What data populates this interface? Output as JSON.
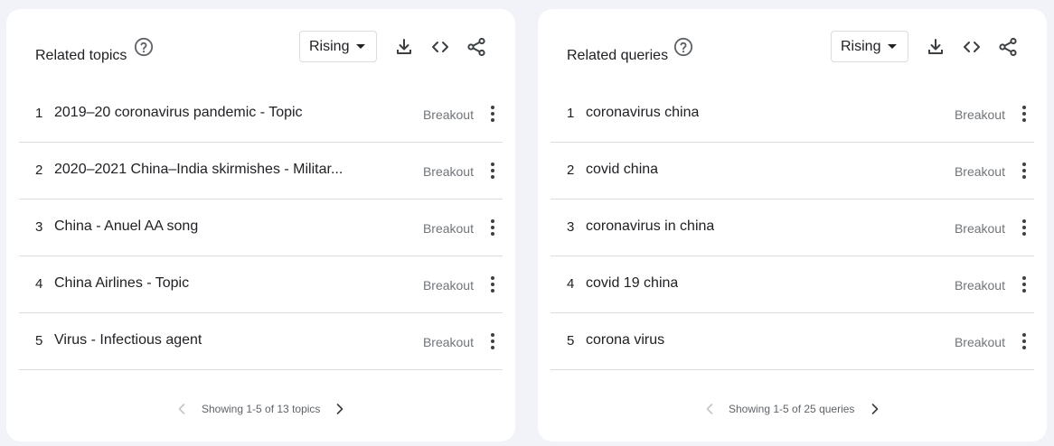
{
  "topics": {
    "title": "Related topics",
    "dropdown_value": "Rising",
    "icons": {
      "help": "help-circle-icon",
      "download": "download-icon",
      "embed": "code-embed-icon",
      "share": "share-icon",
      "more": "more-vert-icon",
      "prev": "chevron-left-icon",
      "next": "chevron-right-icon"
    },
    "rows": [
      {
        "rank": "1",
        "label": "2019–20 coronavirus pandemic - Topic",
        "value": "Breakout"
      },
      {
        "rank": "2",
        "label": "2020–2021 China–India skirmishes - Militar...",
        "value": "Breakout"
      },
      {
        "rank": "3",
        "label": "China - Anuel AA song",
        "value": "Breakout"
      },
      {
        "rank": "4",
        "label": "China Airlines - Topic",
        "value": "Breakout"
      },
      {
        "rank": "5",
        "label": "Virus - Infectious agent",
        "value": "Breakout"
      }
    ],
    "pager_text": "Showing 1-5 of 13 topics"
  },
  "queries": {
    "title": "Related queries",
    "dropdown_value": "Rising",
    "rows": [
      {
        "rank": "1",
        "label": "coronavirus china",
        "value": "Breakout"
      },
      {
        "rank": "2",
        "label": "covid china",
        "value": "Breakout"
      },
      {
        "rank": "3",
        "label": "coronavirus in china",
        "value": "Breakout"
      },
      {
        "rank": "4",
        "label": "covid 19 china",
        "value": "Breakout"
      },
      {
        "rank": "5",
        "label": "corona virus",
        "value": "Breakout"
      }
    ],
    "pager_text": "Showing 1-5 of 25 queries"
  },
  "colors": {
    "background": "#f1f3f8",
    "card": "#ffffff",
    "divider": "#dadce0",
    "muted_text": "#70757a"
  }
}
